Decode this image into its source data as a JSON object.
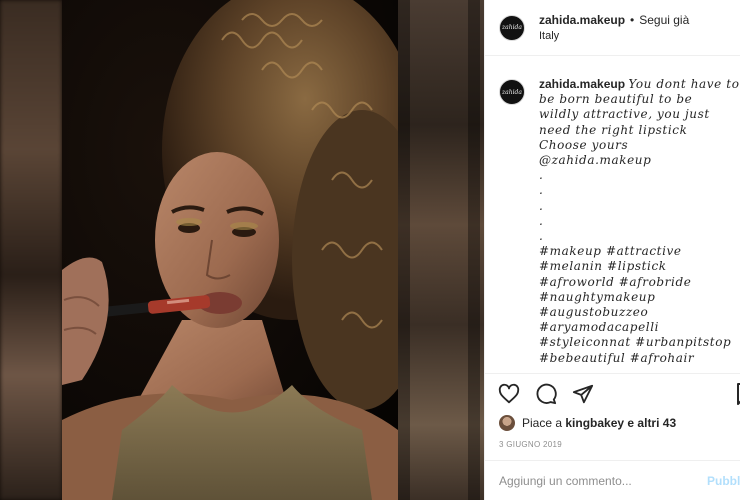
{
  "post": {
    "image_alt": "Woman with curly hair holding a lipstick to her lips"
  },
  "header": {
    "avatar_text": "zahida",
    "username": "zahida.makeup",
    "separator": "•",
    "follow_state": "Segui già",
    "location": "Italy"
  },
  "caption": {
    "username": "zahida.makeup",
    "lines": [
      "You dont have to",
      "be born beautiful  to be",
      "wildly attractive, you just",
      "need the right lipstick",
      "Choose yours",
      "@zahida.makeup",
      ".",
      ".",
      ".",
      ".",
      ".",
      "#makeup #attractive",
      "#melanin #lipstick",
      "#afroworld #afrobride",
      "#naughtymakeup",
      "#augustobuzzeo",
      "#aryamodacapelli",
      "#styleiconnat #urbanpitstop",
      "#bebeautiful #afrohair"
    ]
  },
  "actions": {
    "like_icon": "heart-icon",
    "comment_icon": "comment-bubble-icon",
    "share_icon": "paper-plane-icon",
    "save_icon": "bookmark-icon"
  },
  "likes": {
    "prefix": "Piace a",
    "user": "kingbakey",
    "suffix": "e altri 43"
  },
  "date": "3 giugno 2019",
  "comment": {
    "placeholder": "Aggiungi un commento...",
    "publish_label": "Pubblica"
  },
  "colors": {
    "publish_disabled": "#b2dffc",
    "border": "#efefef",
    "muted_text": "#8e8e8e"
  }
}
